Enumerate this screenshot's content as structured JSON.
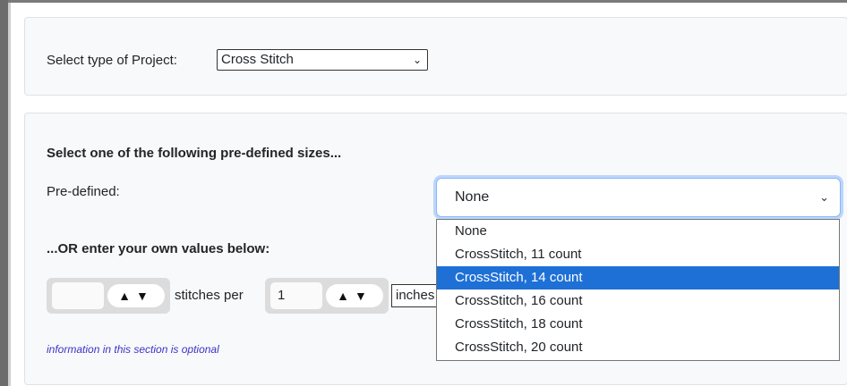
{
  "project": {
    "label": "Select type of Project:",
    "selected": "Cross Stitch",
    "chevron_icon": "chevron-down-icon"
  },
  "predefined": {
    "heading": "Select one of the following pre-defined sizes...",
    "label": "Pre-defined:",
    "selected": "None",
    "options": [
      "None",
      "CrossStitch, 11 count",
      "CrossStitch, 14 count",
      "CrossStitch, 16 count",
      "CrossStitch, 18 count",
      "CrossStitch, 20 count"
    ],
    "highlighted_option": "CrossStitch, 14 count",
    "highlight_color": "#1e70d6"
  },
  "custom": {
    "heading": "...OR enter your own values below:",
    "stitches_value": "",
    "stitches_per_label": "stitches per",
    "per_value": "1",
    "units_value": "inches",
    "spinner_glyphs": "▲▼",
    "note": "information in this section is optional",
    "note_color": "#3b33c9"
  }
}
